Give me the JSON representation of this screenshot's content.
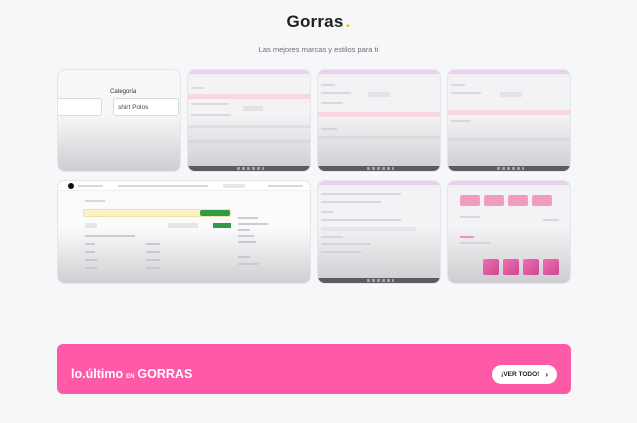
{
  "header": {
    "title": "Gorras",
    "title_dot": ".",
    "subtitle": "Las mejores marcas y estilos para ti"
  },
  "gallery": {
    "tile1": {
      "category_label": "Categoría",
      "field_value": "shirt Polos"
    }
  },
  "banner": {
    "title_main": "lo.último",
    "title_small": "EN",
    "title_end": "GORRAS",
    "button_label": "¡VER TODO!",
    "button_icon": "chevron-right-icon"
  },
  "colors": {
    "accent_pink": "#ff5aa8",
    "dot_yellow": "#f2b21b",
    "background": "#f6f7f9"
  }
}
